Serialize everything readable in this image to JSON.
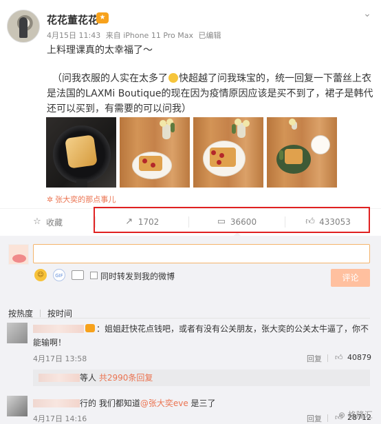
{
  "post": {
    "username": "花花董花花",
    "date": "4月15日 11:43",
    "source": "来自 iPhone 11 Pro Max",
    "edited": "已编辑",
    "text_line1": "上料理课真的太幸福了～",
    "text_paragraph": "（问我衣服的人实在太多了",
    "text_paragraph_cont": "快超越了问我珠宝的，统一回复一下蕾丝上衣是法国的LAXMi Boutique的现在因为疫情原因应该是买不到了，裙子是韩代还可以买到，有需要的可以问我）",
    "source_tag": "张大奕的那点事儿"
  },
  "actions": {
    "favorite": "收藏",
    "repost": "1702",
    "comment": "36600",
    "like": "433053"
  },
  "composer": {
    "placeholder": "",
    "repost_label": "同时转发到我的微博",
    "submit": "评论"
  },
  "sort": {
    "hot": "按热度",
    "time": "按时间"
  },
  "comments": [
    {
      "text": "：姐姐赶快花点钱吧，或者有没有公关朋友，张大奕的公关太牛逼了，你不能输啊！",
      "time": "4月17日 13:58",
      "reply": "回复",
      "likes": "40879",
      "sub_suffix": "等人",
      "sub_count": "共2990条回复"
    },
    {
      "text_pre": "行的 我们都知道",
      "mention": "@张大奕eve",
      "text_post": " 是三了",
      "time": "4月17日 14:16",
      "reply": "回复",
      "likes": "28712"
    }
  ],
  "watermark": "格隆汇"
}
